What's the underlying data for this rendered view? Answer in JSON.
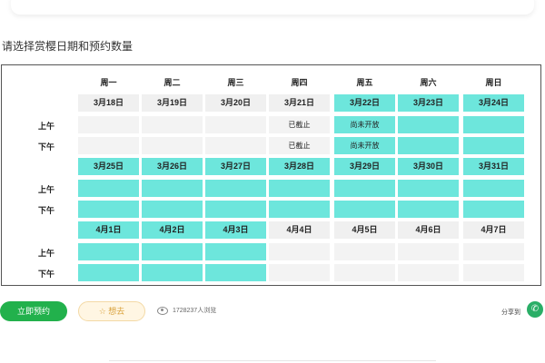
{
  "section_title": "请选择赏樱日期和预约数量",
  "weekdays": [
    "周一",
    "周二",
    "周三",
    "周四",
    "周五",
    "周六",
    "周日"
  ],
  "row_labels": [
    "上午",
    "下午"
  ],
  "weeks": [
    {
      "dates": [
        {
          "label": "3月18日",
          "status": "gray"
        },
        {
          "label": "3月19日",
          "status": "gray"
        },
        {
          "label": "3月20日",
          "status": "gray"
        },
        {
          "label": "3月21日",
          "status": "gray"
        },
        {
          "label": "3月22日",
          "status": "open"
        },
        {
          "label": "3月23日",
          "status": "open"
        },
        {
          "label": "3月24日",
          "status": "open"
        }
      ],
      "am": [
        {
          "text": "",
          "status": "empty"
        },
        {
          "text": "",
          "status": "empty"
        },
        {
          "text": "",
          "status": "empty"
        },
        {
          "text": "已截止",
          "status": "empty"
        },
        {
          "text": "尚未开放",
          "status": "open"
        },
        {
          "text": "",
          "status": "open"
        },
        {
          "text": "",
          "status": "open"
        }
      ],
      "pm": [
        {
          "text": "",
          "status": "empty"
        },
        {
          "text": "",
          "status": "empty"
        },
        {
          "text": "",
          "status": "empty"
        },
        {
          "text": "已截止",
          "status": "empty"
        },
        {
          "text": "尚未开放",
          "status": "open"
        },
        {
          "text": "",
          "status": "open"
        },
        {
          "text": "",
          "status": "open"
        }
      ]
    },
    {
      "dates": [
        {
          "label": "3月25日",
          "status": "open"
        },
        {
          "label": "3月26日",
          "status": "open"
        },
        {
          "label": "3月27日",
          "status": "open"
        },
        {
          "label": "3月28日",
          "status": "open"
        },
        {
          "label": "3月29日",
          "status": "open"
        },
        {
          "label": "3月30日",
          "status": "open"
        },
        {
          "label": "3月31日",
          "status": "open"
        }
      ],
      "am": [
        {
          "text": "",
          "status": "open"
        },
        {
          "text": "",
          "status": "open"
        },
        {
          "text": "",
          "status": "open"
        },
        {
          "text": "",
          "status": "open"
        },
        {
          "text": "",
          "status": "open"
        },
        {
          "text": "",
          "status": "open"
        },
        {
          "text": "",
          "status": "open"
        }
      ],
      "pm": [
        {
          "text": "",
          "status": "open"
        },
        {
          "text": "",
          "status": "open"
        },
        {
          "text": "",
          "status": "open"
        },
        {
          "text": "",
          "status": "open"
        },
        {
          "text": "",
          "status": "open"
        },
        {
          "text": "",
          "status": "open"
        },
        {
          "text": "",
          "status": "open"
        }
      ]
    },
    {
      "dates": [
        {
          "label": "4月1日",
          "status": "open"
        },
        {
          "label": "4月2日",
          "status": "open"
        },
        {
          "label": "4月3日",
          "status": "open"
        },
        {
          "label": "4月4日",
          "status": "gray"
        },
        {
          "label": "4月5日",
          "status": "gray"
        },
        {
          "label": "4月6日",
          "status": "gray"
        },
        {
          "label": "4月7日",
          "status": "gray"
        }
      ],
      "am": [
        {
          "text": "",
          "status": "open"
        },
        {
          "text": "",
          "status": "open"
        },
        {
          "text": "",
          "status": "open"
        },
        {
          "text": "",
          "status": "empty"
        },
        {
          "text": "",
          "status": "empty"
        },
        {
          "text": "",
          "status": "empty"
        },
        {
          "text": "",
          "status": "empty"
        }
      ],
      "pm": [
        {
          "text": "",
          "status": "open"
        },
        {
          "text": "",
          "status": "open"
        },
        {
          "text": "",
          "status": "open"
        },
        {
          "text": "",
          "status": "empty"
        },
        {
          "text": "",
          "status": "empty"
        },
        {
          "text": "",
          "status": "empty"
        },
        {
          "text": "",
          "status": "empty"
        }
      ]
    }
  ],
  "actions": {
    "book_label": "立即预约",
    "fav_label": "想去",
    "views_text": "1728237人浏览",
    "share_label": "分享到"
  },
  "colors": {
    "open": "#6de6dc",
    "gray": "#f0f0f0",
    "primary": "#22b14c"
  },
  "icons": {
    "fav": "star-icon",
    "views": "eye-icon",
    "share": "wechat-icon"
  }
}
